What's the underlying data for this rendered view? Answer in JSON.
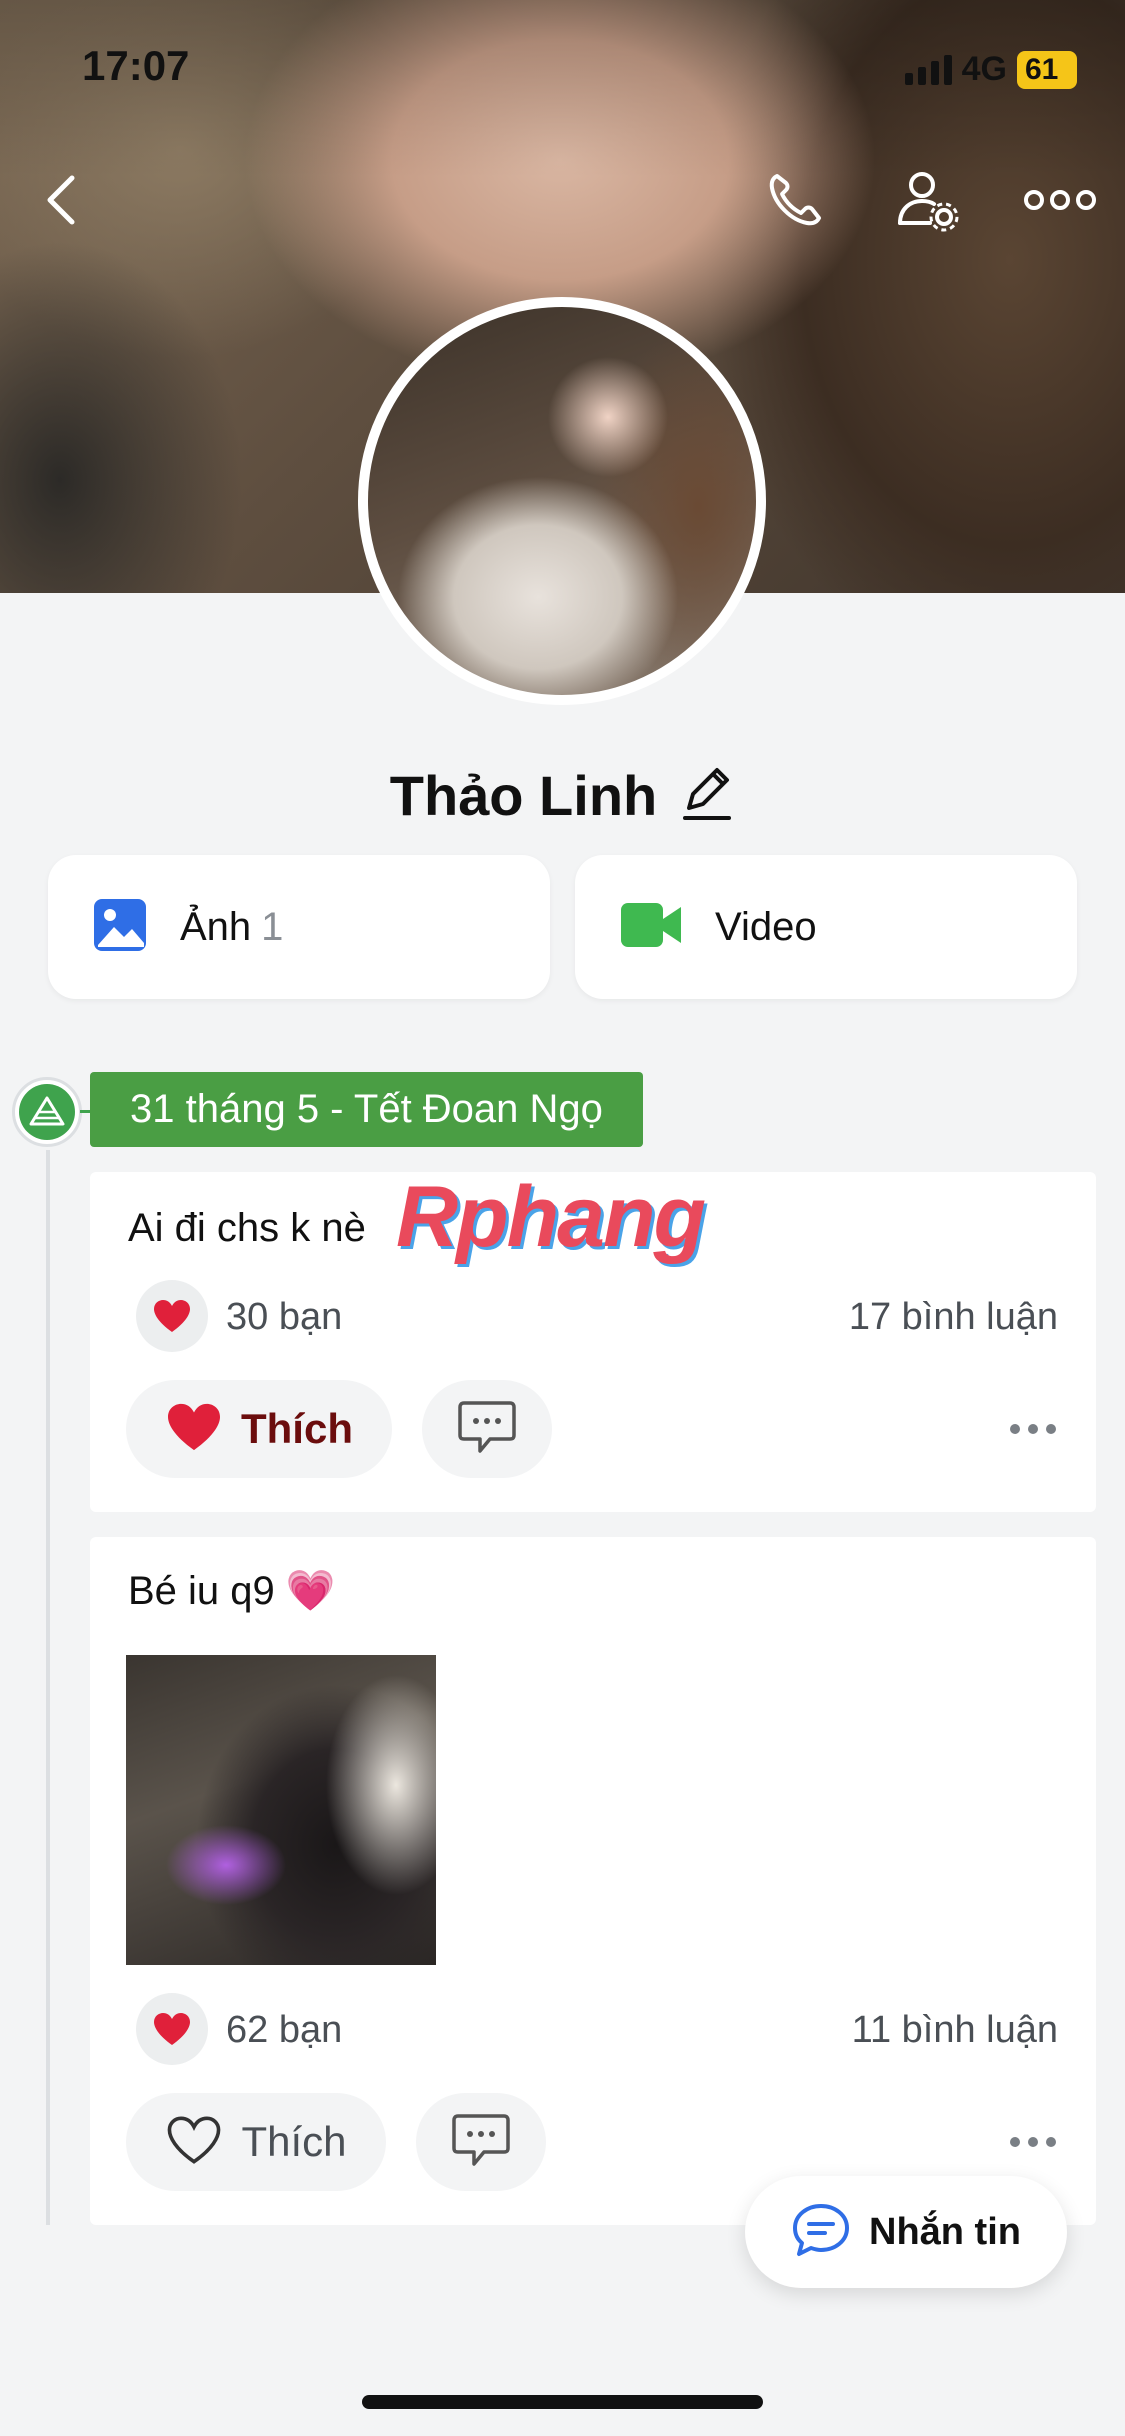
{
  "status_bar": {
    "time": "17:07",
    "network": "4G",
    "battery": "61"
  },
  "header": {
    "back_icon": "chevron-left-icon",
    "call_icon": "phone-icon",
    "settings_icon": "user-settings-icon",
    "more_icon": "more-horizontal-icon"
  },
  "profile": {
    "name": "Thảo Linh",
    "edit_icon": "pencil-icon"
  },
  "media": {
    "photos": {
      "label": "Ảnh",
      "count": "1",
      "icon": "image-icon",
      "color": "#2f6ee6"
    },
    "videos": {
      "label": "Video",
      "icon": "video-camera-icon",
      "color": "#3fb950"
    }
  },
  "timeline": {
    "date_tag": "31 tháng 5 - Tết Đoan Ngọ",
    "tag_color": "#4a9e44"
  },
  "watermark": "Rphang",
  "posts": [
    {
      "text": "Ai đi chs k nè",
      "reactions": "30 bạn",
      "comments": "17 bình luận",
      "like_label": "Thích",
      "liked": true
    },
    {
      "text": "Bé iu q9 💗",
      "reactions": "62 bạn",
      "comments": "11 bình luận",
      "like_label": "Thích",
      "liked": false
    }
  ],
  "fab": {
    "label": "Nhắn tin",
    "icon": "chat-bubble-icon",
    "color": "#2f6ee6"
  }
}
